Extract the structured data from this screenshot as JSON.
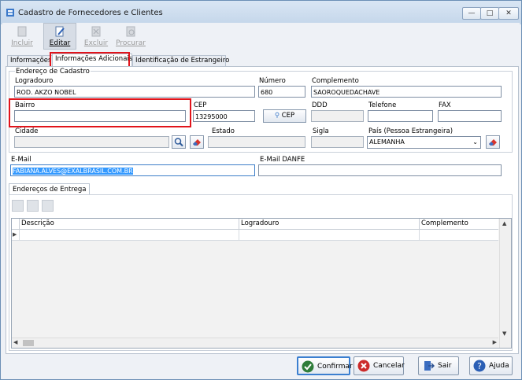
{
  "window": {
    "title": "Cadastro de Fornecedores e Clientes",
    "min": "—",
    "max": "□",
    "close": "✕"
  },
  "toolbar": {
    "incluir": "Incluir",
    "editar": "Editar",
    "excluir": "Excluir",
    "procurar": "Procurar"
  },
  "tabs": [
    "Informações",
    "Informações Adicionais",
    "Identificação de Estrangeiro"
  ],
  "endereco": {
    "group_title": "Endereço de Cadastro",
    "logradouro_label": "Logradouro",
    "logradouro": "ROD. AKZO NOBEL",
    "numero_label": "Número",
    "numero": "680",
    "complemento_label": "Complemento",
    "complemento": "SAOROQUEDACHAVE",
    "bairro_label": "Bairro",
    "bairro": "",
    "cep_label": "CEP",
    "cep": "13295000",
    "cep_button": "CEP",
    "ddd_label": "DDD",
    "ddd": "",
    "telefone_label": "Telefone",
    "telefone": "",
    "fax_label": "FAX",
    "fax": "",
    "cidade_label": "Cidade",
    "cidade": "",
    "estado_label": "Estado",
    "estado": "",
    "sigla_label": "Sigla",
    "sigla": "",
    "pais_label": "País (Pessoa Estrangeira)",
    "pais": "ALEMANHA"
  },
  "email": {
    "label": "E-Mail",
    "value": "FABIANA.ALVES@EXALBRASIL.COM.BR",
    "danfe_label": "E-Mail DANFE",
    "danfe_value": ""
  },
  "entrega": {
    "tab": "Endereços de Entrega",
    "columns": [
      "Descrição",
      "Logradouro",
      "Complemento"
    ],
    "row_marker": "▶"
  },
  "footer": {
    "confirmar": "Confirmar",
    "cancelar": "Cancelar",
    "sair": "Sair",
    "ajuda": "Ajuda"
  },
  "colors": {
    "highlight": "#e1141b",
    "selection": "#3399ff"
  }
}
